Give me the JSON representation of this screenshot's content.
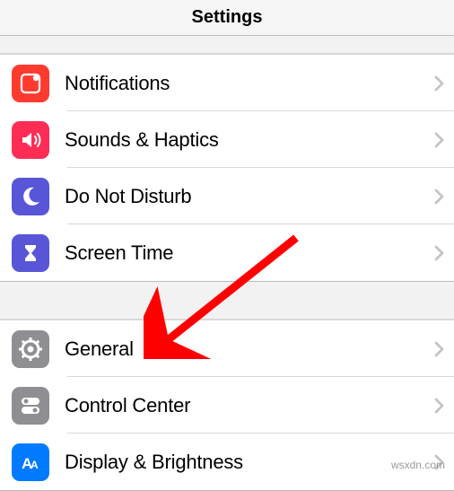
{
  "header": {
    "title": "Settings"
  },
  "section1": {
    "items": [
      {
        "label": "Notifications",
        "icon_bg": "#ff3b30",
        "icon_name": "notifications-icon"
      },
      {
        "label": "Sounds & Haptics",
        "icon_bg": "#ff2d55",
        "icon_name": "sounds-icon"
      },
      {
        "label": "Do Not Disturb",
        "icon_bg": "#5856d6",
        "icon_name": "moon-icon"
      },
      {
        "label": "Screen Time",
        "icon_bg": "#5856d6",
        "icon_name": "hourglass-icon"
      }
    ]
  },
  "section2": {
    "items": [
      {
        "label": "General",
        "icon_bg": "#8e8e93",
        "icon_name": "gear-icon"
      },
      {
        "label": "Control Center",
        "icon_bg": "#8e8e93",
        "icon_name": "switches-icon"
      },
      {
        "label": "Display & Brightness",
        "icon_bg": "#007aff",
        "icon_name": "text-size-icon"
      }
    ]
  },
  "watermark": "wsxdn.com",
  "arrow_color": "#ff0000"
}
